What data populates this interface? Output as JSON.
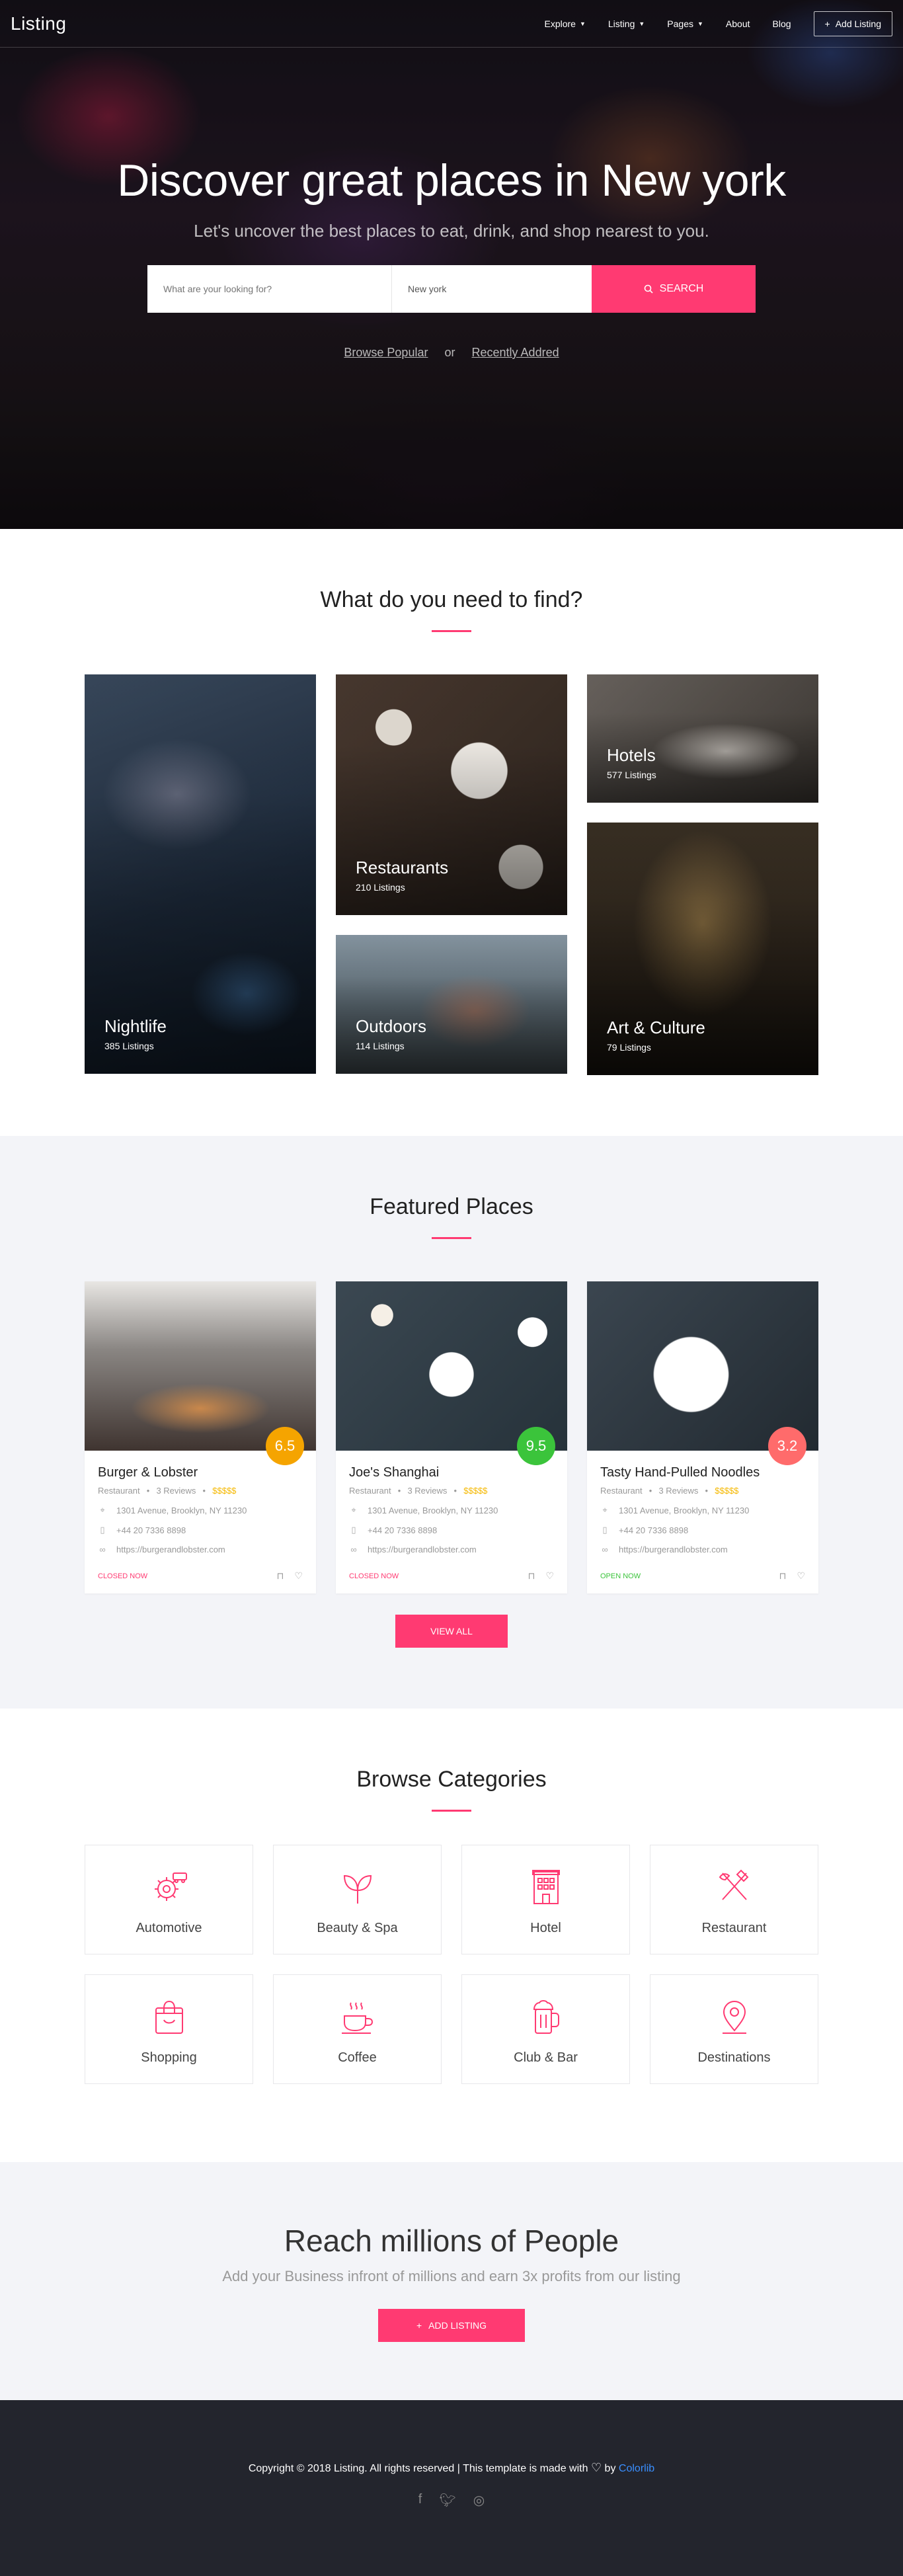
{
  "nav": {
    "brand": "Listing",
    "items": [
      {
        "label": "Explore",
        "has_dropdown": true
      },
      {
        "label": "Listing",
        "has_dropdown": true
      },
      {
        "label": "Pages",
        "has_dropdown": true
      },
      {
        "label": "About",
        "has_dropdown": false
      },
      {
        "label": "Blog",
        "has_dropdown": false
      }
    ],
    "add_listing": "Add Listing"
  },
  "hero": {
    "title": "Discover great places in New york",
    "subtitle": "Let's uncover the best places to eat, drink, and shop nearest to you.",
    "search_placeholder": "What are your looking for?",
    "location_value": "New york",
    "search_button": "SEARCH",
    "link_popular": "Browse Popular",
    "or": "or",
    "link_recent": "Recently Addred"
  },
  "find": {
    "title": "What do you need to find?",
    "tiles": [
      {
        "name": "Nightlife",
        "count": "385 Listings"
      },
      {
        "name": "Restaurants",
        "count": "210 Listings"
      },
      {
        "name": "Outdoors",
        "count": "114 Listings"
      },
      {
        "name": "Hotels",
        "count": "577 Listings"
      },
      {
        "name": "Art & Culture",
        "count": "79 Listings"
      }
    ]
  },
  "featured": {
    "title": "Featured Places",
    "view_all": "VIEW ALL",
    "cards": [
      {
        "name": "Burger & Lobster",
        "category": "Restaurant",
        "reviews": "3 Reviews",
        "price": "$$$$$",
        "address": "1301 Avenue, Brooklyn, NY 11230",
        "phone": "+44 20 7336 8898",
        "website": "https://burgerandlobster.com",
        "status": "CLOSED NOW",
        "score": "6.5",
        "score_color": "#f5a400"
      },
      {
        "name": "Joe's Shanghai",
        "category": "Restaurant",
        "reviews": "3 Reviews",
        "price": "$$$$$",
        "address": "1301 Avenue, Brooklyn, NY 11230",
        "phone": "+44 20 7336 8898",
        "website": "https://burgerandlobster.com",
        "status": "CLOSED NOW",
        "score": "9.5",
        "score_color": "#3bc43b"
      },
      {
        "name": "Tasty Hand-Pulled Noodles",
        "category": "Restaurant",
        "reviews": "3 Reviews",
        "price": "$$$$$",
        "address": "1301 Avenue, Brooklyn, NY 11230",
        "phone": "+44 20 7336 8898",
        "website": "https://burgerandlobster.com",
        "status": "OPEN NOW",
        "score": "3.2",
        "score_color": "#ff6b6b"
      }
    ]
  },
  "categories": {
    "title": "Browse Categories",
    "items": [
      {
        "label": "Automotive",
        "icon": "gear-car-icon"
      },
      {
        "label": "Beauty & Spa",
        "icon": "leaf-icon"
      },
      {
        "label": "Hotel",
        "icon": "building-icon"
      },
      {
        "label": "Restaurant",
        "icon": "utensils-icon"
      },
      {
        "label": "Shopping",
        "icon": "shopping-bag-icon"
      },
      {
        "label": "Coffee",
        "icon": "coffee-cup-icon"
      },
      {
        "label": "Club & Bar",
        "icon": "beer-mug-icon"
      },
      {
        "label": "Destinations",
        "icon": "map-pin-icon"
      }
    ]
  },
  "cta": {
    "title": "Reach millions of People",
    "subtitle": "Add your Business infront of millions and earn 3x profits from our listing",
    "button": "ADD LISTING"
  },
  "footer": {
    "copyright": "Copyright © 2018 Listing. All rights reserved | This template is made with",
    "by": "by",
    "credit": "Colorlib",
    "socials": [
      "facebook-icon",
      "twitter-icon",
      "instagram-icon"
    ]
  },
  "colors": {
    "accent": "#ff3a72",
    "open": "#3bc43b",
    "footer_bg": "#23252d",
    "section_bg": "#f3f4f8"
  }
}
